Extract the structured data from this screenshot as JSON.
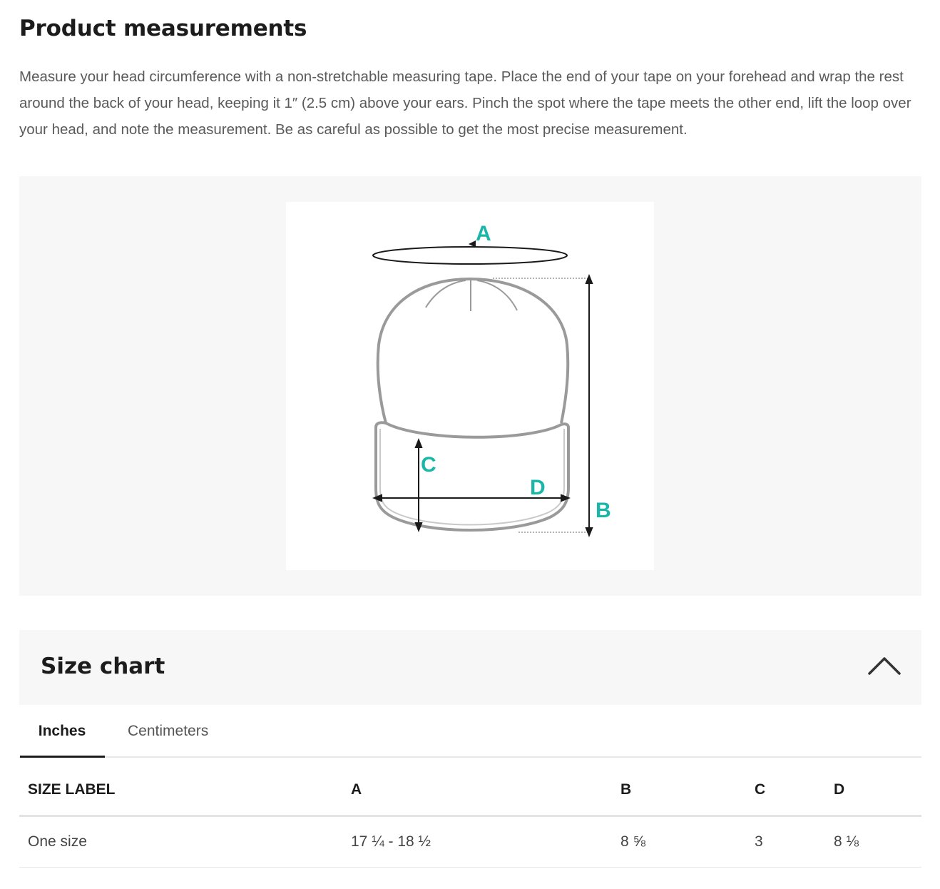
{
  "product_measurements": {
    "title": "Product measurements",
    "description": "Measure your head circumference with a non-stretchable measuring tape. Place the end of your  tape on your forehead and wrap the rest around the back of your head, keeping it 1″ (2.5 cm) above your ears. Pinch the spot where the tape meets the other end, lift the loop over your head, and note the measurement. Be as careful as possible to get the most precise measurement."
  },
  "diagram": {
    "labels": {
      "a": "A",
      "b": "B",
      "c": "C",
      "d": "D"
    },
    "label_color": "#1ab6a8",
    "outline_color": "#9a9a9a"
  },
  "size_chart": {
    "title": "Size chart",
    "toggle_icon": "chevron-up-icon",
    "tabs": [
      {
        "label": "Inches",
        "active": true
      },
      {
        "label": "Centimeters",
        "active": false
      }
    ],
    "headers": [
      "SIZE LABEL",
      "A",
      "B",
      "C",
      "D"
    ],
    "rows": [
      [
        "One size",
        "17 ¼ - 18 ½",
        "8 ⅝",
        "3",
        "8 ⅛"
      ]
    ]
  }
}
